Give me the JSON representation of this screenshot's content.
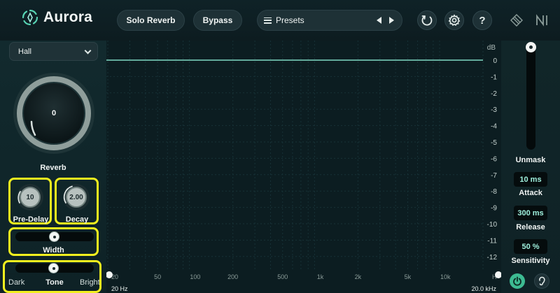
{
  "app": {
    "name": "Aurora"
  },
  "toolbar": {
    "solo_reverb": "Solo Reverb",
    "bypass": "Bypass",
    "presets": "Presets",
    "help": "?"
  },
  "left_panel": {
    "mode_select": "Hall",
    "reverb": {
      "value": "0",
      "label": "Reverb"
    },
    "pre_delay": {
      "value": "10",
      "label": "Pre-Delay"
    },
    "decay": {
      "value": "2.00",
      "label": "Decay"
    },
    "width": {
      "label": "Width",
      "level": 0.5
    },
    "tone": {
      "label": "Tone",
      "min_label": "Dark",
      "max_label": "Bright",
      "level": 0.5
    }
  },
  "graph": {
    "db_unit": "dB",
    "db_ticks": [
      "0",
      "-1",
      "-2",
      "-3",
      "-4",
      "-5",
      "-6",
      "-7",
      "-8",
      "-9",
      "-10",
      "-11",
      "-12"
    ],
    "freq_ticks": [
      "20",
      "50",
      "100",
      "200",
      "500",
      "1k",
      "2k",
      "5k",
      "10k",
      "H"
    ],
    "freq_min_label": "20 Hz",
    "freq_max_label": "20.0 kHz",
    "curve_level_db": 0
  },
  "right_panel": {
    "unmask": {
      "label": "Unmask",
      "level": 1.0
    },
    "attack": {
      "value": "10 ms",
      "label": "Attack"
    },
    "release": {
      "value": "300 ms",
      "label": "Release"
    },
    "sensitivity": {
      "value": "50 %",
      "label": "Sensitivity"
    }
  },
  "colors": {
    "accent": "#3dbb92",
    "highlight": "#f1ef1e",
    "value_text": "#9ff0dd",
    "curve": "#7fd9c4"
  },
  "icons": {
    "undo": "undo-icon",
    "settings": "gear-icon",
    "help": "help-icon",
    "power": "power-icon",
    "listen": "ear-icon"
  }
}
